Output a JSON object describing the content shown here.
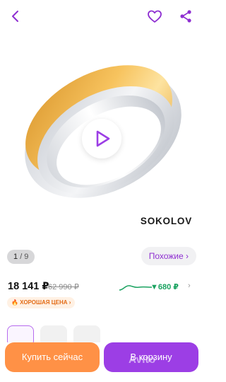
{
  "header": {
    "back_icon": "chevron-left-icon",
    "favorite_icon": "heart-icon",
    "share_icon": "share-icon",
    "accent": "#8e2ed1"
  },
  "gallery": {
    "brand": "SOKOLOV",
    "play_icon": "play-icon",
    "page_current": "1",
    "page_total": "/ 9"
  },
  "similar_label": "Похожие ›",
  "price": {
    "current": "18 141 ₽",
    "old": "62 990 ₽",
    "drop": "▼680 ₽",
    "drop_chevron": "›",
    "drop_color": "#1aa260"
  },
  "badge": {
    "label": "🔥 ХОРОШАЯ ЦЕНА ›",
    "color": "#e36c17"
  },
  "actions": {
    "buy_label": "Купить сейчас",
    "buy_color": "#ff9146",
    "cart_label": "В корзину",
    "cart_color": "#9c3ee5"
  },
  "watermark": "Avito"
}
